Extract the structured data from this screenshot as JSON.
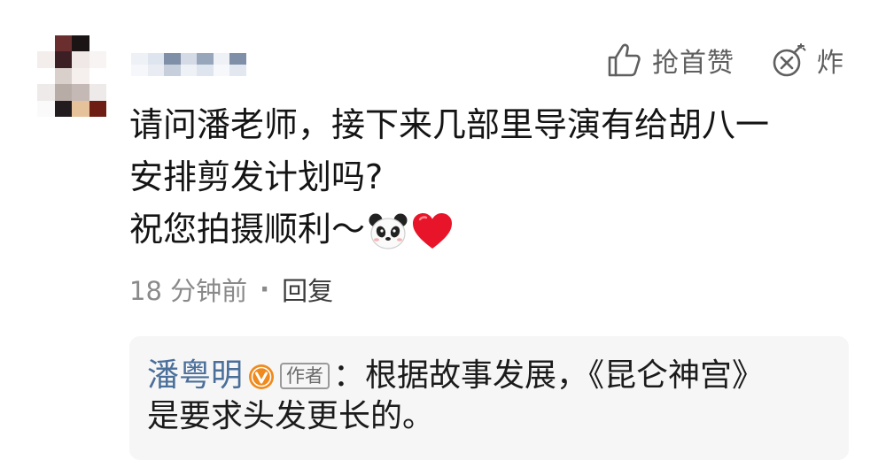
{
  "actions": {
    "like_label": "抢首赞",
    "bomb_label": "炸"
  },
  "comment": {
    "lines": [
      "请问潘老师，接下来几部里导演有给胡八一",
      "安排剪发计划吗?",
      "祝您拍摄顺利～"
    ],
    "emojis": [
      "panda-emoji",
      "red-heart-emoji"
    ]
  },
  "meta": {
    "time": "18 分钟前",
    "separator": "·",
    "reply_label": "回复"
  },
  "reply": {
    "author": "潘粤明",
    "author_tag": "作者",
    "colon": "：",
    "text_line1": "根据故事发展，《昆仑神宫》",
    "text_line2": "是要求头发更长的。"
  },
  "colors": {
    "author_link": "#4a6f9a",
    "verified_badge": "#f08a1c",
    "reply_background": "#f6f6f6",
    "icon_gray": "#5f5f5f"
  }
}
